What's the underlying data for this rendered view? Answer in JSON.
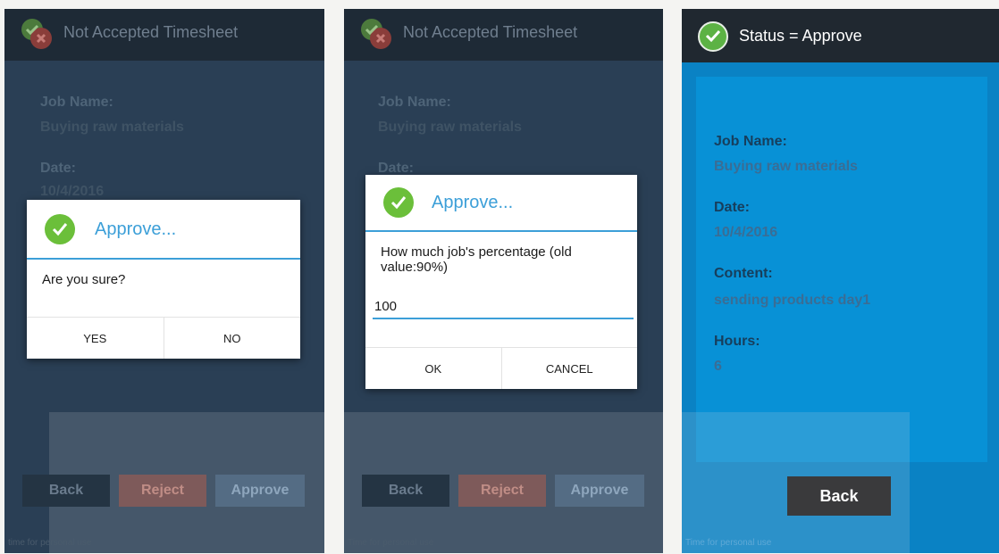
{
  "screens": [
    {
      "title": "Not Accepted Timesheet",
      "fields": {
        "job_name_label": "Job Name:",
        "job_name_value": "Buying raw materials",
        "date_label": "Date:",
        "date_value": "10/4/2016"
      },
      "buttons": {
        "back": "Back",
        "reject": "Reject",
        "approve": "Approve"
      },
      "footer": "time for personal use",
      "dialog": {
        "title": "Approve...",
        "message": "Are you sure?",
        "yes": "YES",
        "no": "NO"
      }
    },
    {
      "title": "Not Accepted Timesheet",
      "fields": {
        "job_name_label": "Job Name:",
        "job_name_value": "Buying raw materials",
        "date_label": "Date:"
      },
      "buttons": {
        "back": "Back",
        "reject": "Reject",
        "approve": "Approve"
      },
      "footer": "Time for personal use",
      "dialog": {
        "title": "Approve...",
        "message": "How much job's percentage (old value:90%)",
        "input_value": "100",
        "ok": "OK",
        "cancel": "CANCEL"
      }
    },
    {
      "title": "Status = Approve",
      "fields": {
        "job_name_label": "Job Name:",
        "job_name_value": "Buying raw materials",
        "date_label": "Date:",
        "date_value": "10/4/2016",
        "content_label": "Content:",
        "content_value": "sending products day1",
        "hours_label": "Hours:",
        "hours_value": "6"
      },
      "buttons": {
        "back": "Back"
      },
      "footer": "Time for personal use"
    }
  ],
  "colors": {
    "accent": "#3c9fd8",
    "check_green": "#6bbf3a",
    "reject_red": "#b55a4a",
    "approve_blue": "#3b6f9c",
    "status_bg": "#0a82c4"
  }
}
